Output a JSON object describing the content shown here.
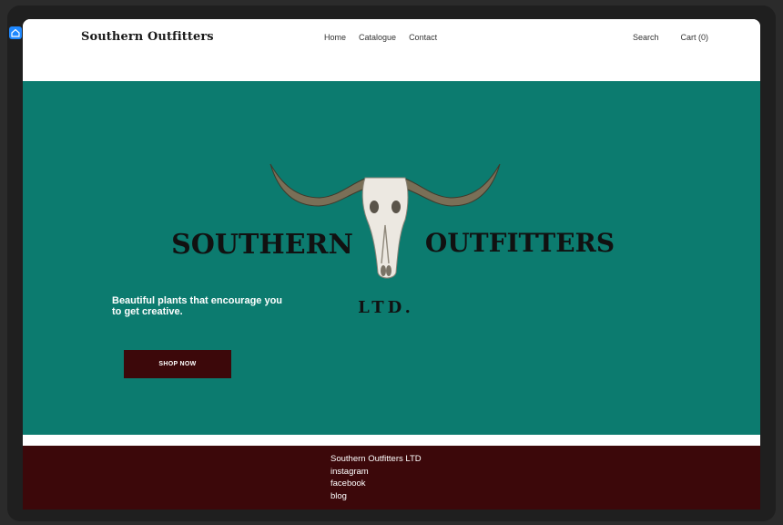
{
  "header": {
    "brand": "Southern Outfitters",
    "nav": {
      "home": "Home",
      "catalogue": "Catalogue",
      "contact": "Contact"
    },
    "search": "Search",
    "cart": "Cart (0)"
  },
  "hero": {
    "logo": {
      "word_left": "SOUTHERN",
      "word_right": "OUTFITTERS",
      "suffix": "LTD."
    },
    "tagline": "Beautiful plants that encourage you to get creative.",
    "button": "SHOP NOW"
  },
  "footer": {
    "company": "Southern Outfitters LTD",
    "instagram": "instagram",
    "facebook": "facebook",
    "blog": "blog"
  },
  "colors": {
    "hero_bg": "#0c7b6f",
    "accent_dark": "#3c080a",
    "frame": "#1f1f1f"
  },
  "icons": {
    "browser_tab": "home-icon"
  }
}
